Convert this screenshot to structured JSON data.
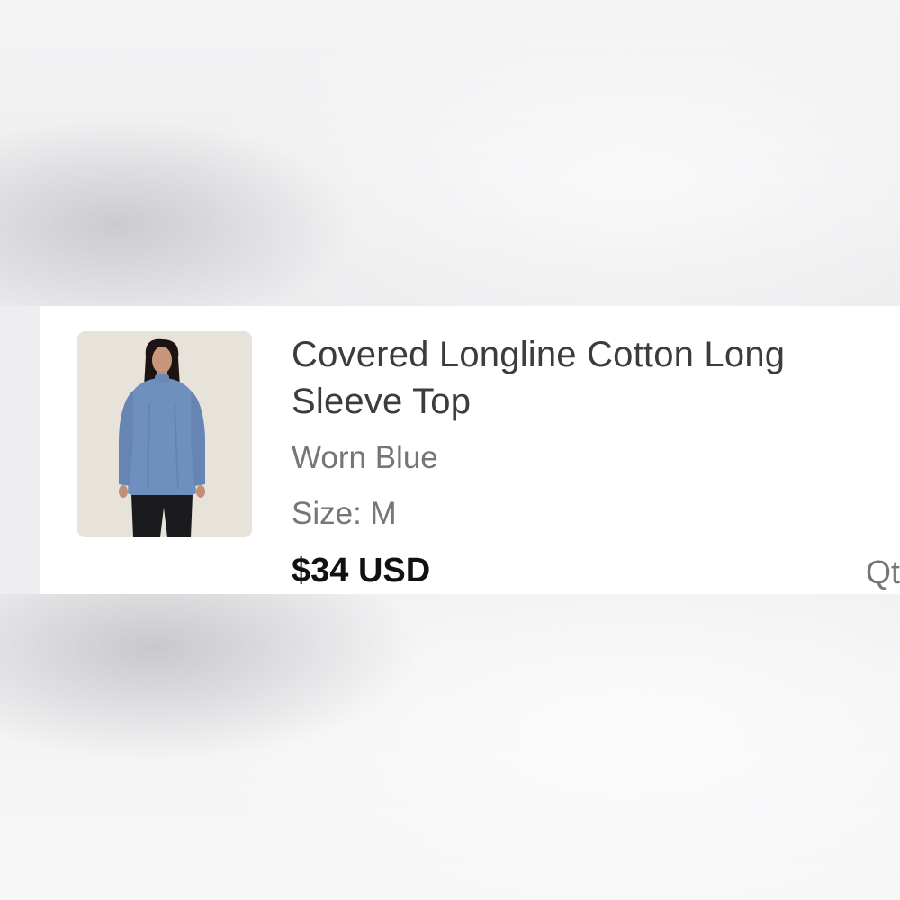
{
  "product": {
    "title": "Covered Longline Cotton Long Sleeve Top",
    "color_label": "Worn Blue",
    "size_label": "Size: M",
    "price": "$34 USD",
    "qty_label": "Qty"
  },
  "thumbnail": {
    "icon": "product-photo-model-in-blue-long-sleeve-top"
  },
  "colors": {
    "background": "#f3f3f4",
    "card": "#ffffff",
    "title_text": "#3c3c3c",
    "secondary_text": "#767676",
    "price_text": "#111111",
    "garment": "#6f8fbe"
  }
}
